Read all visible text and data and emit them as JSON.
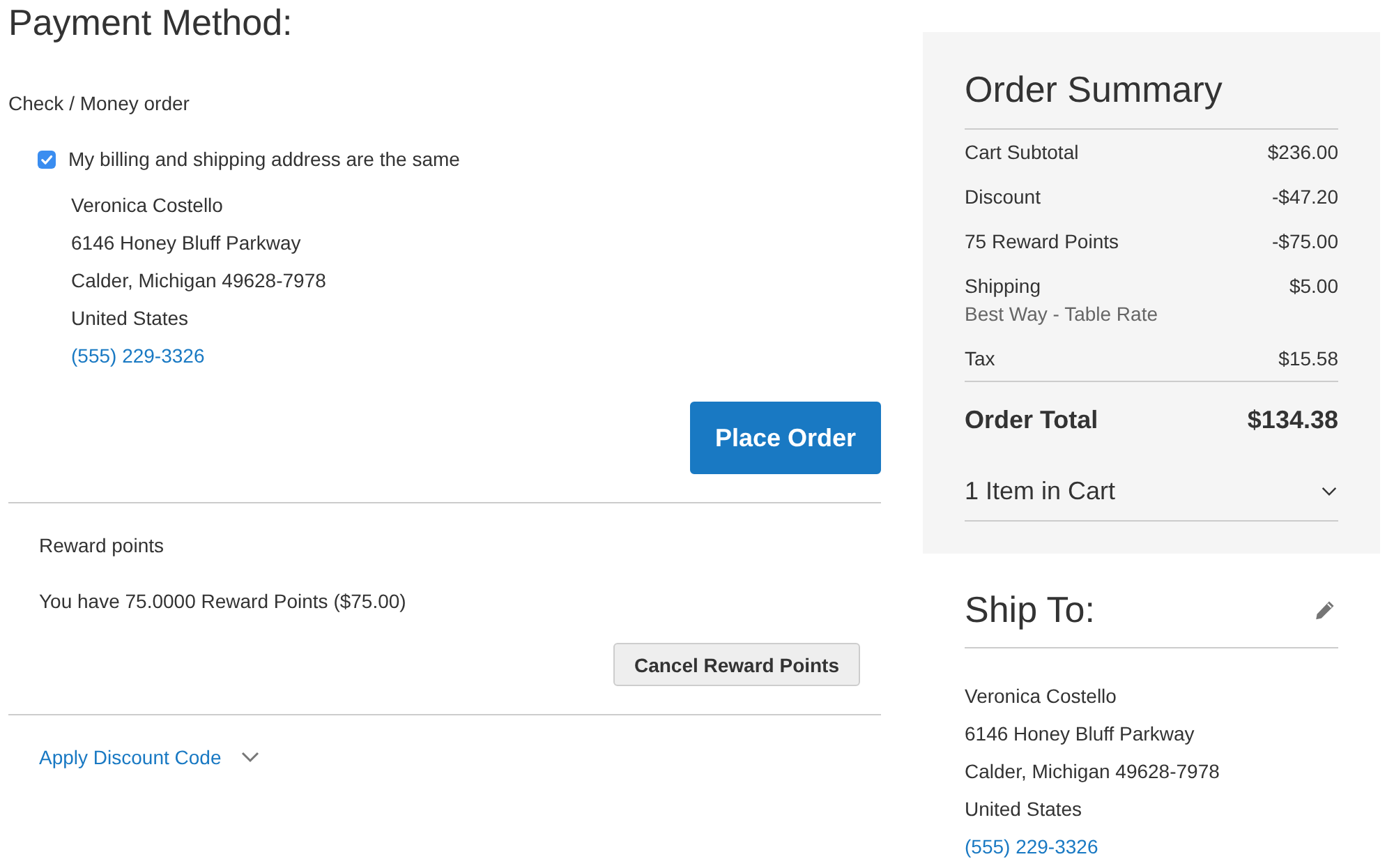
{
  "payment": {
    "title": "Payment Method:",
    "method": "Check / Money order",
    "same_address": {
      "label": "My billing and shipping address are the same",
      "checked": true
    },
    "billing_address": {
      "lines": [
        "Veronica Costello",
        "6146 Honey Bluff Parkway",
        "Calder, Michigan 49628-7978",
        "United States"
      ],
      "phone": "(555) 229-3326"
    },
    "place_order_button": "Place Order"
  },
  "reward_points": {
    "title": "Reward points",
    "balance_text": "You have 75.0000 Reward Points ($75.00)",
    "cancel_button": "Cancel Reward Points"
  },
  "discount": {
    "label": "Apply Discount Code",
    "expanded": false
  },
  "order_summary": {
    "title": "Order Summary",
    "rows": [
      {
        "label": "Cart Subtotal",
        "value": "$236.00"
      },
      {
        "label": "Discount",
        "value": "-$47.20"
      },
      {
        "label": "75 Reward Points",
        "value": "-$75.00"
      },
      {
        "label": "Shipping",
        "value": "$5.00",
        "detail": "Best Way - Table Rate"
      },
      {
        "label": "Tax",
        "value": "$15.58"
      }
    ],
    "total": {
      "label": "Order Total",
      "value": "$134.38"
    },
    "cart_items": {
      "label": "1 Item in Cart",
      "expanded": false
    }
  },
  "ship_to": {
    "title": "Ship To:",
    "lines": [
      "Veronica Costello",
      "6146 Honey Bluff Parkway",
      "Calder, Michigan 49628-7978",
      "United States"
    ],
    "phone": "(555) 229-3326"
  }
}
